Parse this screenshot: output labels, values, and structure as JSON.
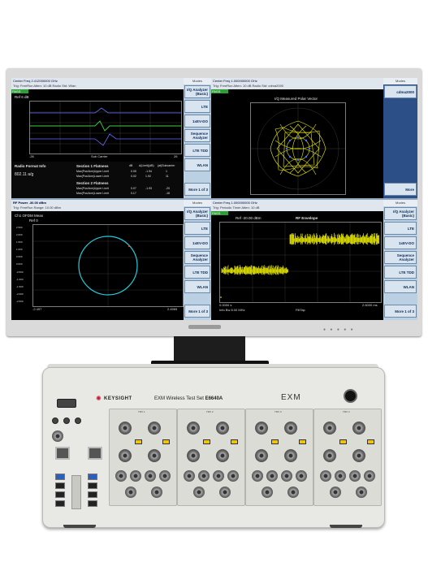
{
  "quad_tl": {
    "header_line1": "Center Freq 2.412000000 GHz",
    "header_line2": "Trig: FreeRun   Atten: 10 dB   Radio Std: Wlan",
    "pass": "PASS",
    "ref": "Ref 6 dB",
    "x_left": "-26",
    "x_center": "Sub Carrier",
    "x_right": "26",
    "info_title": "Radio Format Info",
    "info_value": "802.11 a/g",
    "section1_title": "Section 1 Flatness",
    "section2_title": "Section 2 Flatness",
    "table_headers": [
      "dB",
      "Δ(Limit)(dB)",
      "(at)Subcarrier"
    ],
    "table_rows": [
      {
        "label": "Max(Pos/Ave)Upper Limit",
        "v1": "0.05",
        "v2": "-1.94",
        "v3": "1"
      },
      {
        "label": "Max(Pos/Ave)Lower Limit",
        "v1": "0.02",
        "v2": "1.92",
        "v3": "11"
      },
      {
        "label": "Max(Pos/Ave)Upper Limit",
        "v1": "0.07",
        "v2": "-1.93",
        "v3": "-20"
      },
      {
        "label": "Max(Pos/Ave)Lower Limit",
        "v1": "0.17",
        "v2": "",
        "v3": "-16"
      }
    ]
  },
  "quad_tr": {
    "header_line1": "Center Freq 1.000000000 GHz",
    "header_line2": "Trig: FreeRun   Atten: 10 dB   Radio Std: cdma2000",
    "pass": "PASS",
    "plot_title": "I/Q Measured Polar Vector"
  },
  "quad_bl": {
    "header_line1": "RF Power -30.00 dBm",
    "header_line2": "Trig: FreeRun   Range: 10.00 dBm",
    "title": "Ch1 OFDM Meas",
    "ref": "Ref 0",
    "y_ticks": [
      "2.500",
      "2.000",
      "1.500",
      "1.000",
      "0.500",
      "0.000",
      "-0.500",
      "-1.000",
      "-1.500",
      "-2.000",
      "-2.500"
    ],
    "x_left": "-2.497",
    "x_right": "2.4969"
  },
  "quad_br": {
    "header_line1": "Center Freq 1.000000000 GHz",
    "header_line2": "Trig: Periodic Timer   Atten: 10 dB",
    "pass": "PASS",
    "ref": "Ref -20.00 dBm",
    "title": "RF Envelope",
    "x_left": "0.0000 s",
    "x_left2": "Info Bw 8.00 MHz",
    "x_center": "FiltTap",
    "x_right": "2.6000 ms"
  },
  "softkeys_top": [
    "Modes",
    "I/Q Analyzer (Basic)",
    "LTE",
    "1xEV-DO",
    "Sequence Analyzer",
    "LTE TDD",
    "WLAN",
    "More 1 of 3"
  ],
  "softkeys_top_right": [
    "Modes",
    "cdma2000",
    "More"
  ],
  "softkeys_bottom": [
    "Modes",
    "I/Q Analyzer (Basic)",
    "LTE",
    "1xEV-DO",
    "Sequence Analyzer",
    "LTE TDD",
    "WLAN",
    "More 1 of 3"
  ],
  "chassis": {
    "brand": "KEYSIGHT",
    "model_name": "EXM Wireless Test Set",
    "model_number": "E6640A",
    "badge": "EXM",
    "trx_labels": [
      "TRX 1",
      "TRX 2",
      "TRX 3",
      "TRX 4"
    ]
  },
  "colors": {
    "trace_yellow": "#f2f200",
    "circle_cyan": "#27c9d8",
    "softkey_bg": "#d8e4f0"
  }
}
